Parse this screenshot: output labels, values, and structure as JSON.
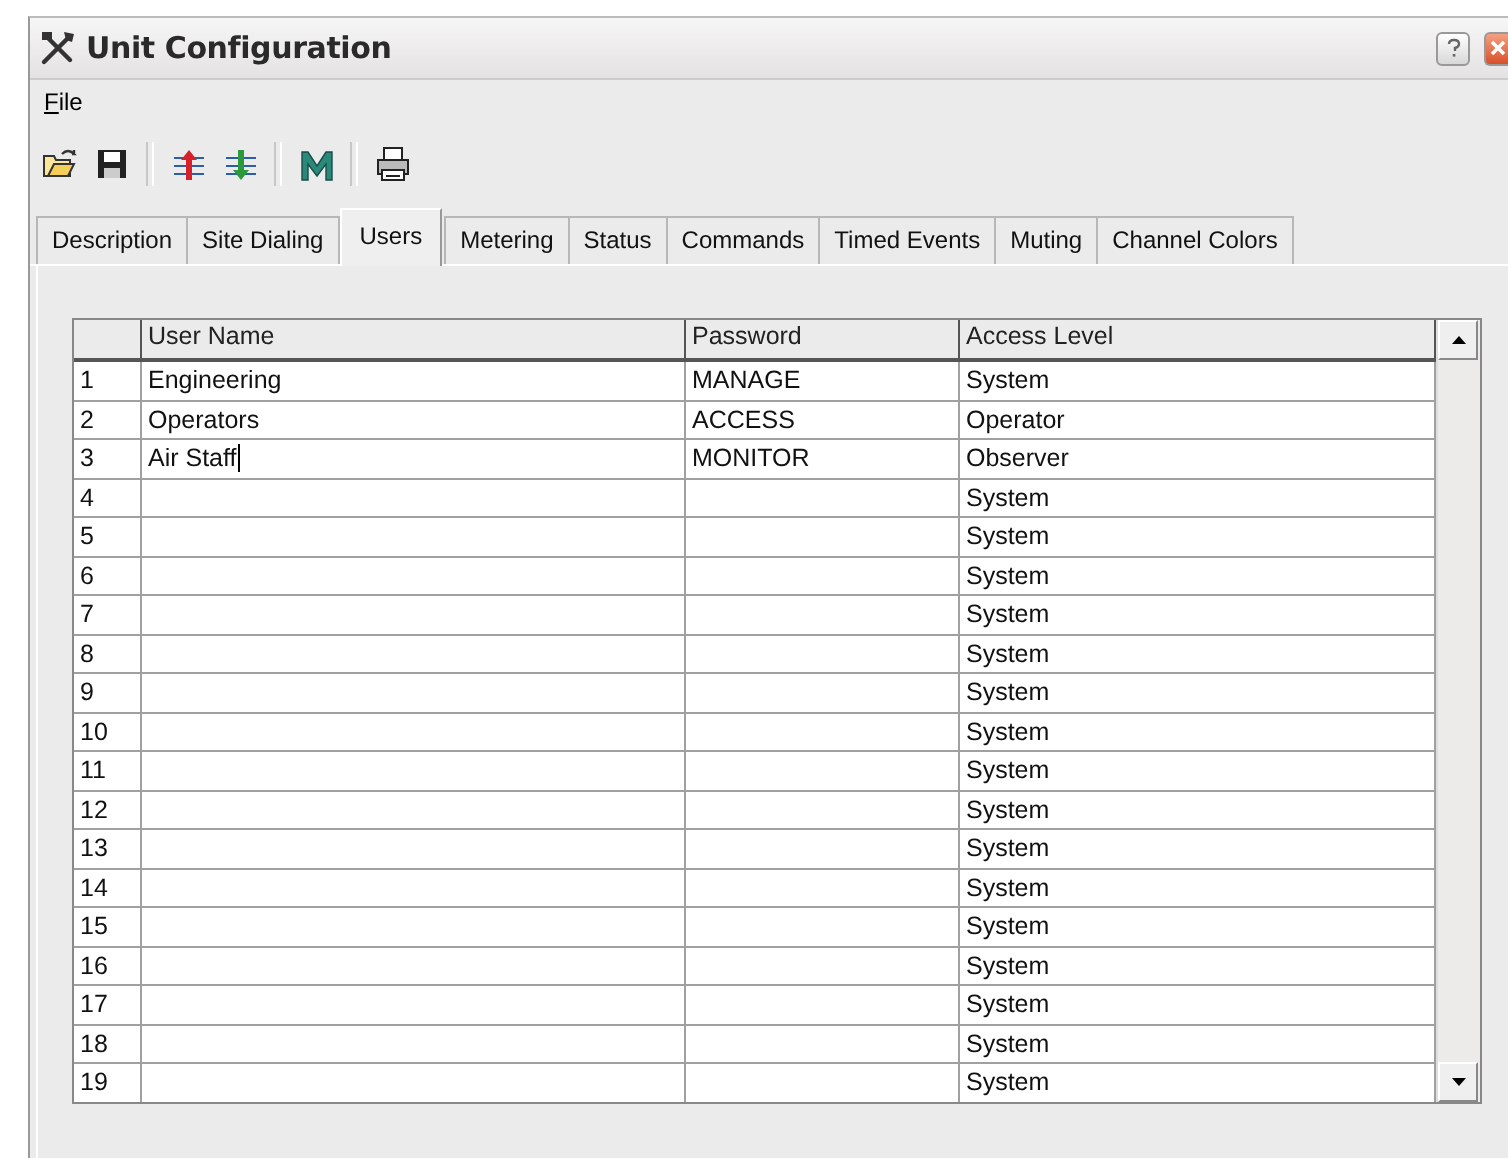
{
  "window": {
    "title": "Unit Configuration"
  },
  "menu": [
    {
      "label": "File"
    }
  ],
  "toolbar": [
    {
      "kind": "open"
    },
    {
      "kind": "save"
    },
    {
      "kind": "separator"
    },
    {
      "kind": "upload"
    },
    {
      "kind": "download"
    },
    {
      "kind": "separator"
    },
    {
      "kind": "m"
    },
    {
      "kind": "separator"
    },
    {
      "kind": "print"
    }
  ],
  "tabs": [
    {
      "label": "Description",
      "selected": false
    },
    {
      "label": "Site Dialing",
      "selected": false
    },
    {
      "label": "Users",
      "selected": true
    },
    {
      "label": "Metering",
      "selected": false
    },
    {
      "label": "Status",
      "selected": false
    },
    {
      "label": "Commands",
      "selected": false
    },
    {
      "label": "Timed Events",
      "selected": false
    },
    {
      "label": "Muting",
      "selected": false
    },
    {
      "label": "Channel Colors",
      "selected": false
    }
  ],
  "table": {
    "columns": [
      "User Name",
      "Password",
      "Access Level"
    ],
    "rows": [
      {
        "number": "1",
        "user_name": "Engineering",
        "password": "MANAGE",
        "access_level": "System",
        "editing": false
      },
      {
        "number": "2",
        "user_name": "Operators",
        "password": "ACCESS",
        "access_level": "Operator",
        "editing": false
      },
      {
        "number": "3",
        "user_name": "Air Staff",
        "password": "MONITOR",
        "access_level": "Observer",
        "editing": true
      },
      {
        "number": "4",
        "access_level": "System",
        "editing": false
      },
      {
        "number": "5",
        "access_level": "System",
        "editing": false
      },
      {
        "number": "6",
        "access_level": "System",
        "editing": false
      },
      {
        "number": "7",
        "access_level": "System",
        "editing": false
      },
      {
        "number": "8",
        "access_level": "System",
        "editing": false
      },
      {
        "number": "9",
        "access_level": "System",
        "editing": false
      },
      {
        "number": "10",
        "access_level": "System",
        "editing": false
      },
      {
        "number": "11",
        "access_level": "System",
        "editing": false
      },
      {
        "number": "12",
        "access_level": "System",
        "editing": false
      },
      {
        "number": "13",
        "access_level": "System",
        "editing": false
      },
      {
        "number": "14",
        "access_level": "System",
        "editing": false
      },
      {
        "number": "15",
        "access_level": "System",
        "editing": false
      },
      {
        "number": "16",
        "access_level": "System",
        "editing": false
      },
      {
        "number": "17",
        "access_level": "System",
        "editing": false
      },
      {
        "number": "18",
        "access_level": "System",
        "editing": false
      },
      {
        "number": "19",
        "access_level": "System",
        "editing": false
      }
    ]
  }
}
